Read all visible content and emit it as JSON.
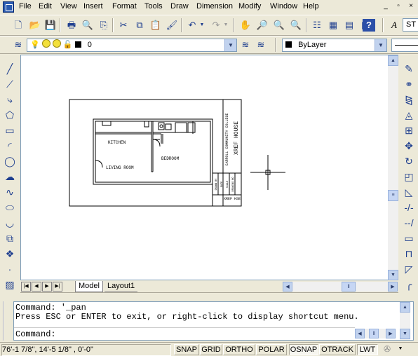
{
  "menu": [
    "File",
    "Edit",
    "View",
    "Insert",
    "Format",
    "Tools",
    "Draw",
    "Dimension",
    "Modify",
    "Window",
    "Help"
  ],
  "window_controls": [
    "_",
    "▫",
    "×"
  ],
  "layers": {
    "current_layer": "0"
  },
  "properties": {
    "color": "ByLayer"
  },
  "text_style": "ST",
  "tabs": [
    "Model",
    "Layout1"
  ],
  "command": {
    "history": [
      "Command: '_pan",
      "Press ESC or ENTER to exit, or right-click to display shortcut menu."
    ],
    "prompt": "Command:"
  },
  "status": {
    "coordinates": "76'-1 7/8\",  14'-5 1/8\" , 0'-0\"",
    "toggles": [
      "SNAP",
      "GRID",
      "ORTHO",
      "POLAR",
      "OSNAP",
      "OTRACK",
      "LWT"
    ]
  },
  "drawing": {
    "rooms": [
      "KITCHEN",
      "LIVING ROOM",
      "BEDROOM"
    ],
    "title_block": {
      "school": "CARROLL COMMUNITY COLLEGE",
      "title": "XREF HOUSE",
      "small_rows": [
        "DRAWN BY",
        "DATE",
        "SCALE",
        "DRAWING NO"
      ],
      "sheet": "XREF HSE"
    }
  },
  "icons": {
    "standard": [
      "new-icon",
      "open-icon",
      "save-icon",
      "print-icon",
      "preview-icon",
      "publish-icon",
      "cut-icon",
      "copy-icon",
      "paste-icon",
      "match-properties-icon",
      "undo-icon",
      "redo-icon",
      "pan-icon",
      "zoom-realtime-icon",
      "zoom-window-icon",
      "zoom-previous-icon",
      "properties-icon",
      "design-center-icon",
      "tool-palettes-icon",
      "dbconnect-icon",
      "help-icon",
      "text-style-icon"
    ],
    "draw": [
      "line-icon",
      "construction-line-icon",
      "polyline-icon",
      "polygon-icon",
      "rectangle-icon",
      "arc-icon",
      "circle-icon",
      "revision-cloud-icon",
      "spline-icon",
      "ellipse-icon",
      "ellipse-arc-icon",
      "insert-block-icon",
      "make-block-icon",
      "point-icon",
      "hatch-icon"
    ],
    "modify": [
      "erase-icon",
      "copy-object-icon",
      "mirror-icon",
      "offset-icon",
      "array-icon",
      "move-icon",
      "rotate-icon",
      "scale-icon",
      "stretch-icon",
      "trim-icon",
      "extend-icon",
      "break-icon",
      "join-icon",
      "chamfer-icon",
      "fillet-icon"
    ]
  }
}
